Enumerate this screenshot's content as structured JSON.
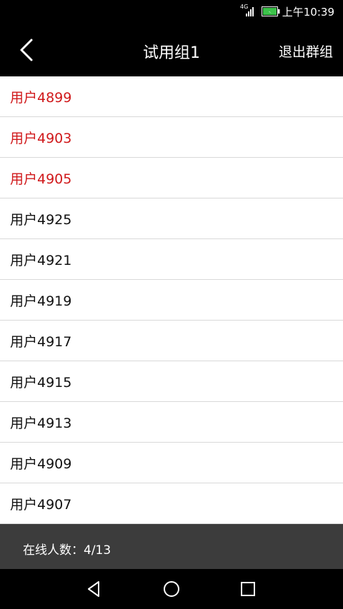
{
  "status_bar": {
    "network_type": "4G",
    "time": "上午10:39",
    "icons": [
      "signal-icon",
      "battery-icon"
    ]
  },
  "header": {
    "title": "试用组1",
    "action_label": "退出群组",
    "back_icon": "chevron-left-icon"
  },
  "members": [
    {
      "name": "用户4899",
      "online": true
    },
    {
      "name": "用户4903",
      "online": true
    },
    {
      "name": "用户4905",
      "online": true
    },
    {
      "name": "用户4925",
      "online": false
    },
    {
      "name": "用户4921",
      "online": false
    },
    {
      "name": "用户4919",
      "online": false
    },
    {
      "name": "用户4917",
      "online": false
    },
    {
      "name": "用户4915",
      "online": false
    },
    {
      "name": "用户4913",
      "online": false
    },
    {
      "name": "用户4909",
      "online": false
    },
    {
      "name": "用户4907",
      "online": false
    }
  ],
  "footer": {
    "online_count_text": "在线人数：4/13"
  },
  "colors": {
    "online": "#d0191b",
    "offline": "#111111",
    "header_bg": "#000000",
    "footer_bg": "#3c3c3c"
  }
}
